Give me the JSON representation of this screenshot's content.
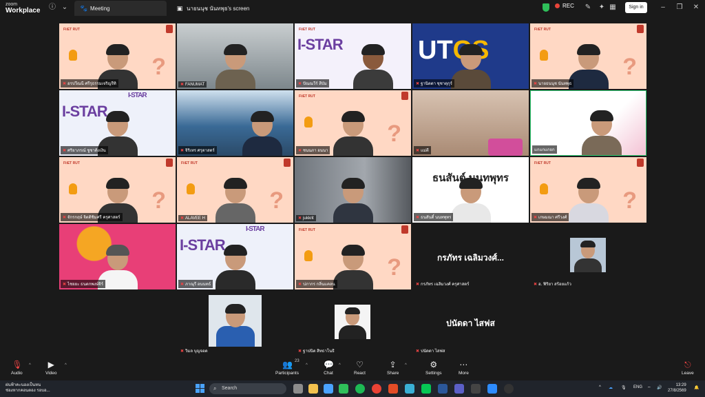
{
  "app": {
    "brand_line1": "zoom",
    "brand_line2": "Workplace"
  },
  "tabs": [
    {
      "label": "Meeting"
    },
    {
      "label": "นายนนุช นันทพุธ's screen"
    }
  ],
  "titlebar": {
    "rec_label": "REC",
    "signin_label": "Sign in"
  },
  "tiles": [
    {
      "name": "อรปวีณนี ศรีรุธรรมเจริญรีทิ"
    },
    {
      "name": "FANUMAT"
    },
    {
      "name": "ปัณณวีร์ สีบัม"
    },
    {
      "name": "ฐานิตตา ชุชาตุกุร์"
    },
    {
      "name": "นายธนนุช นันทพุธ"
    },
    {
      "name": "ศริยาภรณ์ ชูชาติงเงิน"
    },
    {
      "name": "จิริเทร ศรุตาสตร์"
    },
    {
      "name": "ชนนภา อนนา"
    },
    {
      "name": "แม่ตี"
    },
    {
      "name": "แกแกแกยก"
    },
    {
      "name": "จักรกฤษ์ จิตติชิมศรี ครุศาสตร์"
    },
    {
      "name": "ALAVEE H"
    },
    {
      "name": "jukkrit"
    },
    {
      "name": "ธนสันติ์ นนทพุทร"
    },
    {
      "name": "เกษมณา ศรีวงศ์"
    },
    {
      "name": "ไชยยะ ธนตกพงษ์จิร์"
    },
    {
      "name": "ภาณุรี อนนทธ์"
    },
    {
      "name": "ปภากร กลิ่นแคลน"
    }
  ],
  "tile_texts": {
    "istar": "I-STAR",
    "utcc_a": "UT",
    "utcc_b": "CS",
    "thanasan": "ธนสันต์ นนทพุทร",
    "banner": "FiiET RUT"
  },
  "name_only": [
    {
      "display": "กรภัทร เฉลิมวงศ์...",
      "label": "กรภัทร เฉลิมวงศ์ ครุศาสตร์"
    },
    {
      "display": "ปนัดดา ไสฟส",
      "label": "ปนัดดา ไสฟส"
    }
  ],
  "small_tiles": [
    {
      "label": "อ. ฟิริยา สร้อยแก้ว"
    },
    {
      "label": "วิมล บุญจอด"
    },
    {
      "label": "ฐาปนิต สิทธาโนธิ"
    }
  ],
  "toolbar": {
    "audio": "Audio",
    "video": "Video",
    "participants": "Participants",
    "participants_count": "23",
    "chat": "Chat",
    "react": "React",
    "share": "Share",
    "settings": "Settings",
    "more": "More",
    "leave": "Leave"
  },
  "taskbar": {
    "weather_line1": "ฝนฟ้าคะนองเป็นหน",
    "weather_line2": "ช่องหากคอนตอง รอบอ...",
    "search": "Search",
    "lang": "ENG",
    "time": "13:29",
    "date": "27/8/2569"
  }
}
